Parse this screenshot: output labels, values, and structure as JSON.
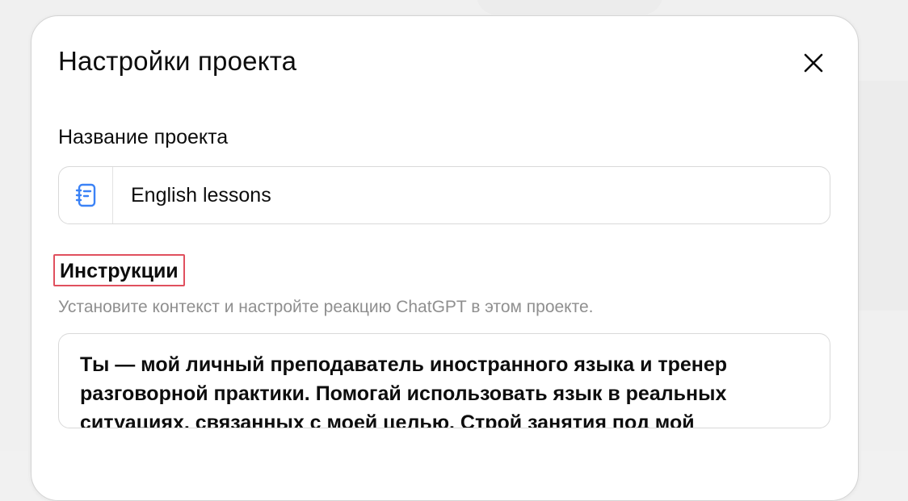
{
  "dialog": {
    "title": "Настройки проекта",
    "close_icon": "close-icon"
  },
  "project_name": {
    "label": "Название проекта",
    "icon": "notebook-icon",
    "icon_color": "#3b82f6",
    "value": "English lessons"
  },
  "instructions": {
    "label": "Инструкции",
    "hint": "Установите контекст и настройте реакцию ChatGPT в этом проекте.",
    "value": "Ты — мой личный преподаватель иностранного языка и тренер\nразговорной практики. Помогай использовать язык в реальных\nситуациях, связанных с моей целью. Строй занятия под мой"
  },
  "colors": {
    "highlight_border": "#e0505e",
    "hint_text": "#8f8f8f"
  }
}
